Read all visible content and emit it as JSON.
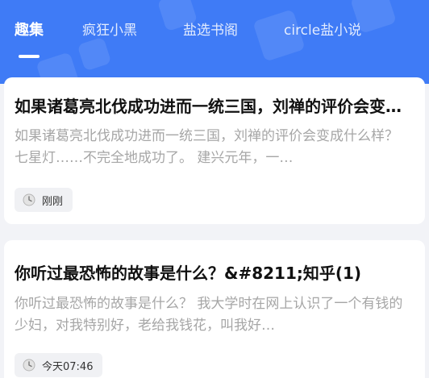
{
  "tabs": [
    {
      "label": "趣集",
      "active": true
    },
    {
      "label": "疯狂小黑",
      "active": false
    },
    {
      "label": "盐选书阁",
      "active": false
    },
    {
      "label": "circle盐小说",
      "active": false
    }
  ],
  "colors": {
    "header": "#3f7bf6",
    "card": "#ffffff",
    "background": "#f2f3f7"
  },
  "cards": [
    {
      "title": "如果诸葛亮北伐成功进而一统三国，刘禅的评价会变成什么样？",
      "summary": "如果诸葛亮北伐成功进而一统三国，刘禅的评价会变成什么样？ 七星灯……不完全地成功了。 建兴元年，一…",
      "time": "刚刚",
      "time_icon": "clock-icon"
    },
    {
      "title": "你听过最恐怖的故事是什么？&#8211;知乎(1)",
      "summary": "你听过最恐怖的故事是什么？ 我大学时在网上认识了一个有钱的少妇，对我特别好，老给我钱花，叫我好…",
      "time": "今天07:46",
      "time_icon": "clock-icon"
    }
  ]
}
